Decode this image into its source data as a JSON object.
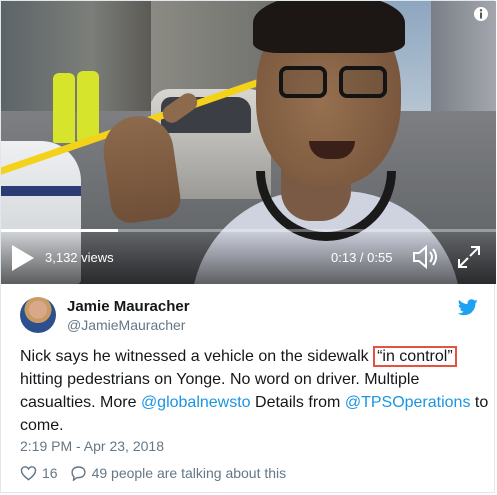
{
  "video": {
    "views": "3,132 views",
    "time": "0:13 / 0:55",
    "progress_fraction": 0.236,
    "icons": [
      "play-icon",
      "volume-icon",
      "fullscreen-icon",
      "info-icon"
    ]
  },
  "tweet": {
    "author_name": "Jamie Mauracher",
    "author_handle": "@JamieMauracher",
    "text_part1": "Nick says he witnessed a vehicle on the sidewalk ",
    "highlighted": "“in control”",
    "text_part2": " hitting pedestrians on Yonge. No word on driver. Multiple casualties. More ",
    "link1": "@globalnewsto",
    "text_part3": " Details from ",
    "link2": "@TPSOperations",
    "text_part4": " to come.",
    "timestamp": "2:19 PM - Apr 23, 2018",
    "likes": "16",
    "conversation": "49 people are talking about this"
  },
  "colors": {
    "link": "#1b95e0",
    "highlight_border": "#e25440",
    "muted": "#657786",
    "twitter_blue": "#1da1f2"
  }
}
